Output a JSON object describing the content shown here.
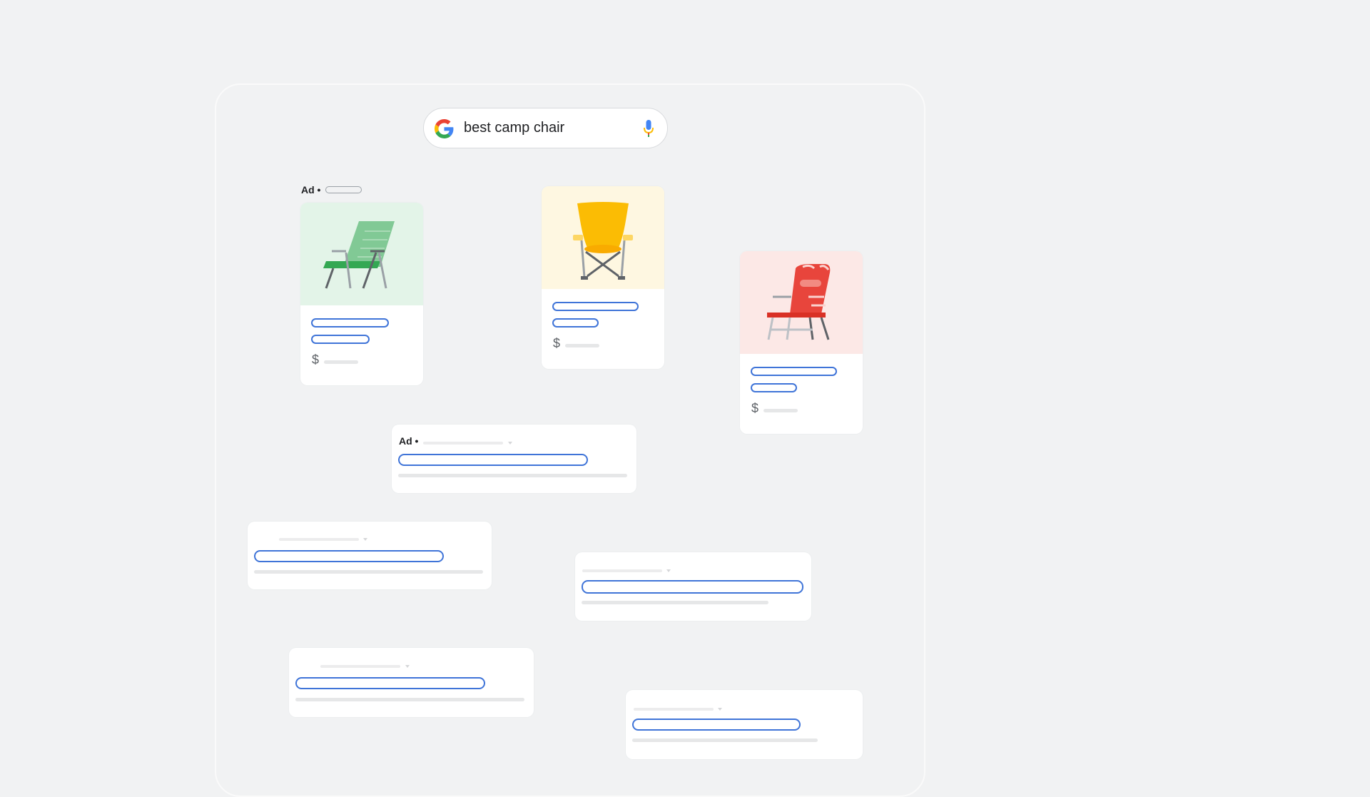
{
  "search": {
    "query": "best camp chair",
    "logo_icon": "google-g-icon",
    "mic_icon": "microphone-icon"
  },
  "ad_label": "Ad •",
  "product_cards": [
    {
      "name": "green-lounge-chair",
      "image_bg": "#e3f4e8",
      "icon": "green-lounge-chair-icon",
      "price_symbol": "$"
    },
    {
      "name": "yellow-folding-chair",
      "image_bg": "#fef7e1",
      "icon": "yellow-folding-chair-icon",
      "price_symbol": "$"
    },
    {
      "name": "red-beach-chair",
      "image_bg": "#fce8e6",
      "icon": "red-beach-chair-icon",
      "price_symbol": "$"
    }
  ],
  "colors": {
    "background": "#f1f2f3",
    "link_blue": "#3f74d8",
    "green": "#34a853",
    "yellow": "#fbbc04",
    "red": "#ea4335"
  }
}
